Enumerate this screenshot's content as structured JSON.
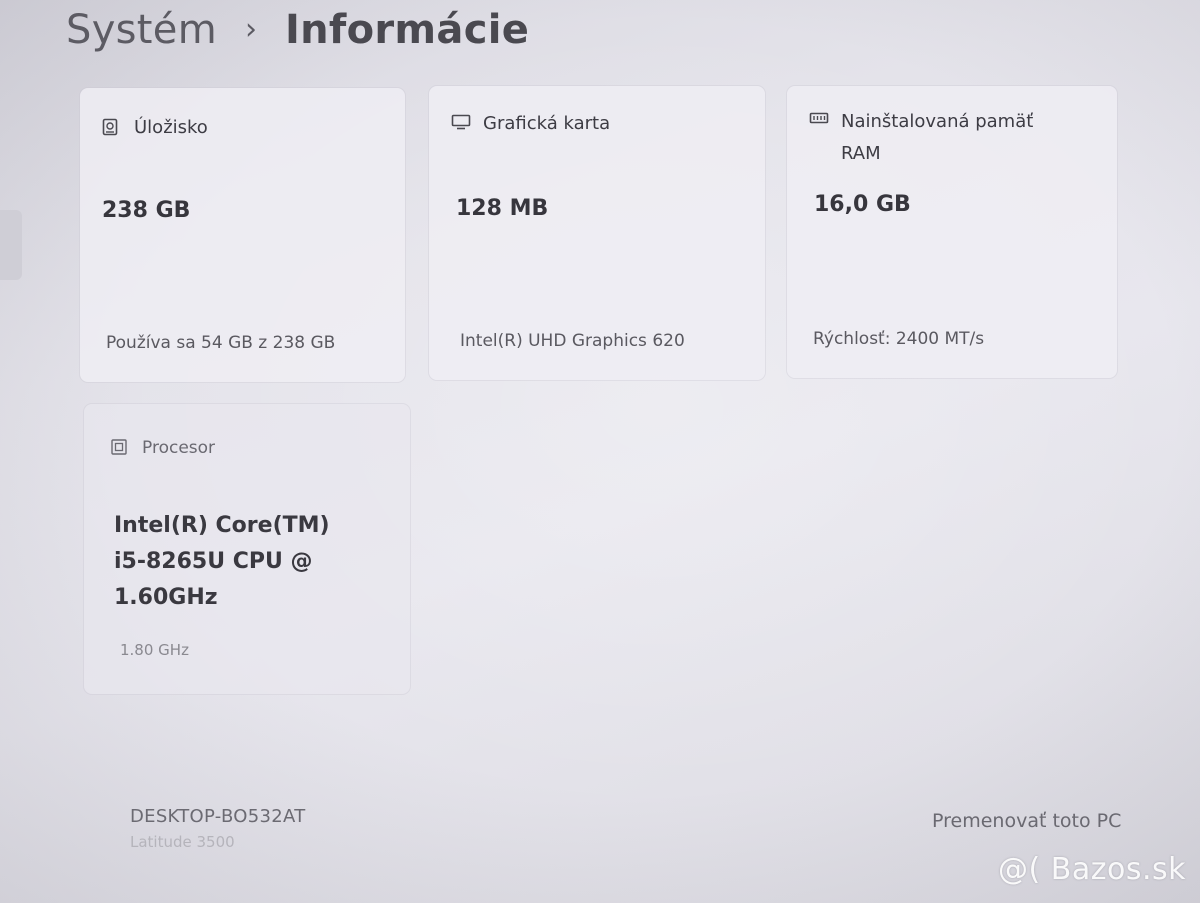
{
  "breadcrumb": {
    "parent": "Systém",
    "separator": "›",
    "current": "Informácie"
  },
  "cards": {
    "storage": {
      "icon": "storage-icon",
      "title": "Úložisko",
      "value": "238 GB",
      "sub": "Používa sa 54 GB z 238 GB"
    },
    "graphics": {
      "icon": "display-icon",
      "title": "Grafická karta",
      "value": "128 MB",
      "sub": "Intel(R) UHD Graphics 620"
    },
    "ram": {
      "icon": "memory-icon",
      "title": "Nainštalovaná pamäť RAM",
      "value": "16,0 GB",
      "sub": "Rýchlosť: 2400 MT/s"
    },
    "cpu": {
      "icon": "processor-icon",
      "title": "Procesor",
      "value": "Intel(R) Core(TM) i5-8265U CPU @ 1.60GHz",
      "sub": "1.80 GHz"
    }
  },
  "device": {
    "name": "DESKTOP-BO532AT",
    "model": "Latitude 3500",
    "rename_label": "Premenovať toto PC"
  },
  "watermark": "@( Bazos.sk",
  "colors": {
    "background": "#e4e3ea",
    "card": "#eeedf3",
    "text": "#3a3940"
  }
}
